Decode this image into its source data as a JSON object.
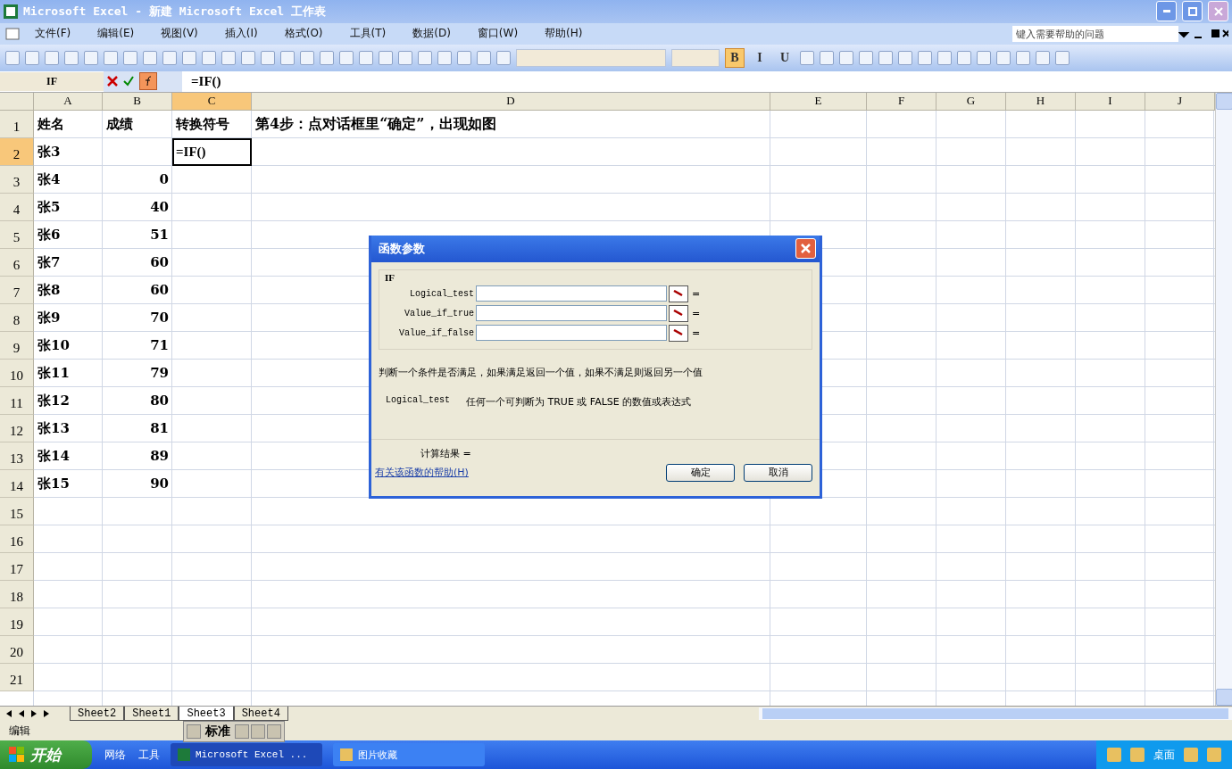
{
  "window": {
    "title": "Microsoft Excel - 新建 Microsoft Excel 工作表"
  },
  "menu": [
    "文件(F)",
    "编辑(E)",
    "视图(V)",
    "插入(I)",
    "格式(O)",
    "工具(T)",
    "数据(D)",
    "窗口(W)",
    "帮助(H)"
  ],
  "help_box": {
    "placeholder": "键入需要帮助的问题"
  },
  "format_buttons": [
    {
      "label": "B",
      "selected": true
    },
    {
      "label": "I",
      "selected": false
    },
    {
      "label": "U",
      "selected": false
    }
  ],
  "formula_bar": {
    "name_box": "IF",
    "formula": "=IF()"
  },
  "columns": [
    {
      "label": "A",
      "selected": false
    },
    {
      "label": "B",
      "selected": false
    },
    {
      "label": "C",
      "selected": true
    },
    {
      "label": "D",
      "selected": false
    },
    {
      "label": "E",
      "selected": false
    },
    {
      "label": "F",
      "selected": false
    },
    {
      "label": "G",
      "selected": false
    },
    {
      "label": "H",
      "selected": false
    },
    {
      "label": "I",
      "selected": false
    },
    {
      "label": "J",
      "selected": false
    }
  ],
  "rows": [
    {
      "number": "1",
      "selected": false,
      "cells": [
        "姓名",
        "成绩",
        "转换符号",
        "第4步：点对话框里“确定”，出现如图"
      ]
    },
    {
      "number": "2",
      "selected": true,
      "cells": [
        "张3",
        null,
        "=IF()"
      ]
    },
    {
      "number": "3",
      "selected": false,
      "cells": [
        "张4",
        "0"
      ]
    },
    {
      "number": "4",
      "selected": false,
      "cells": [
        "张5",
        "40"
      ]
    },
    {
      "number": "5",
      "selected": false,
      "cells": [
        "张6",
        "51"
      ]
    },
    {
      "number": "6",
      "selected": false,
      "cells": [
        "张7",
        "60"
      ]
    },
    {
      "number": "7",
      "selected": false,
      "cells": [
        "张8",
        "60"
      ]
    },
    {
      "number": "8",
      "selected": false,
      "cells": [
        "张9",
        "70"
      ]
    },
    {
      "number": "9",
      "selected": false,
      "cells": [
        "张10",
        "71"
      ]
    },
    {
      "number": "10",
      "selected": false,
      "cells": [
        "张11",
        "79"
      ]
    },
    {
      "number": "11",
      "selected": false,
      "cells": [
        "张12",
        "80"
      ]
    },
    {
      "number": "12",
      "selected": false,
      "cells": [
        "张13",
        "81"
      ]
    },
    {
      "number": "13",
      "selected": false,
      "cells": [
        "张14",
        "89"
      ]
    },
    {
      "number": "14",
      "selected": false,
      "cells": [
        "张15",
        "90"
      ]
    },
    {
      "number": "15",
      "selected": false,
      "cells": []
    },
    {
      "number": "16",
      "selected": false,
      "cells": []
    },
    {
      "number": "17",
      "selected": false,
      "cells": []
    },
    {
      "number": "18",
      "selected": false,
      "cells": []
    },
    {
      "number": "19",
      "selected": false,
      "cells": []
    },
    {
      "number": "20",
      "selected": false,
      "cells": []
    },
    {
      "number": "21",
      "selected": false,
      "cells": []
    }
  ],
  "dialog": {
    "title": "函数参数",
    "function": "IF",
    "arguments": [
      "Logical_test",
      "Value_if_true",
      "Value_if_false"
    ],
    "equals": "=",
    "description": "判断一个条件是否满足，如果满足返回一个值，如果不满足则返回另一个值",
    "arg_name": "Logical_test",
    "arg_help": "任何一个可判断为 TRUE 或 FALSE 的数值或表达式",
    "result_label": "计算结果 =",
    "help_link": "有关该函数的帮助(H)",
    "buttons": [
      "确定",
      "取消"
    ]
  },
  "sheet_tabs": [
    {
      "label": "Sheet2",
      "selected": false
    },
    {
      "label": "Sheet1",
      "selected": false
    },
    {
      "label": "Sheet3",
      "selected": true
    },
    {
      "label": "Sheet4",
      "selected": false
    }
  ],
  "ime_bar": {
    "label": "标准"
  },
  "status": "编辑",
  "taskbar": {
    "start": "开始",
    "quick": [
      "网络",
      "工具"
    ],
    "tasks": [
      {
        "label": "Microsoft Excel ...",
        "selected": true
      },
      {
        "label": "图片收藏",
        "selected": false
      }
    ],
    "tray_text": "桌面"
  }
}
